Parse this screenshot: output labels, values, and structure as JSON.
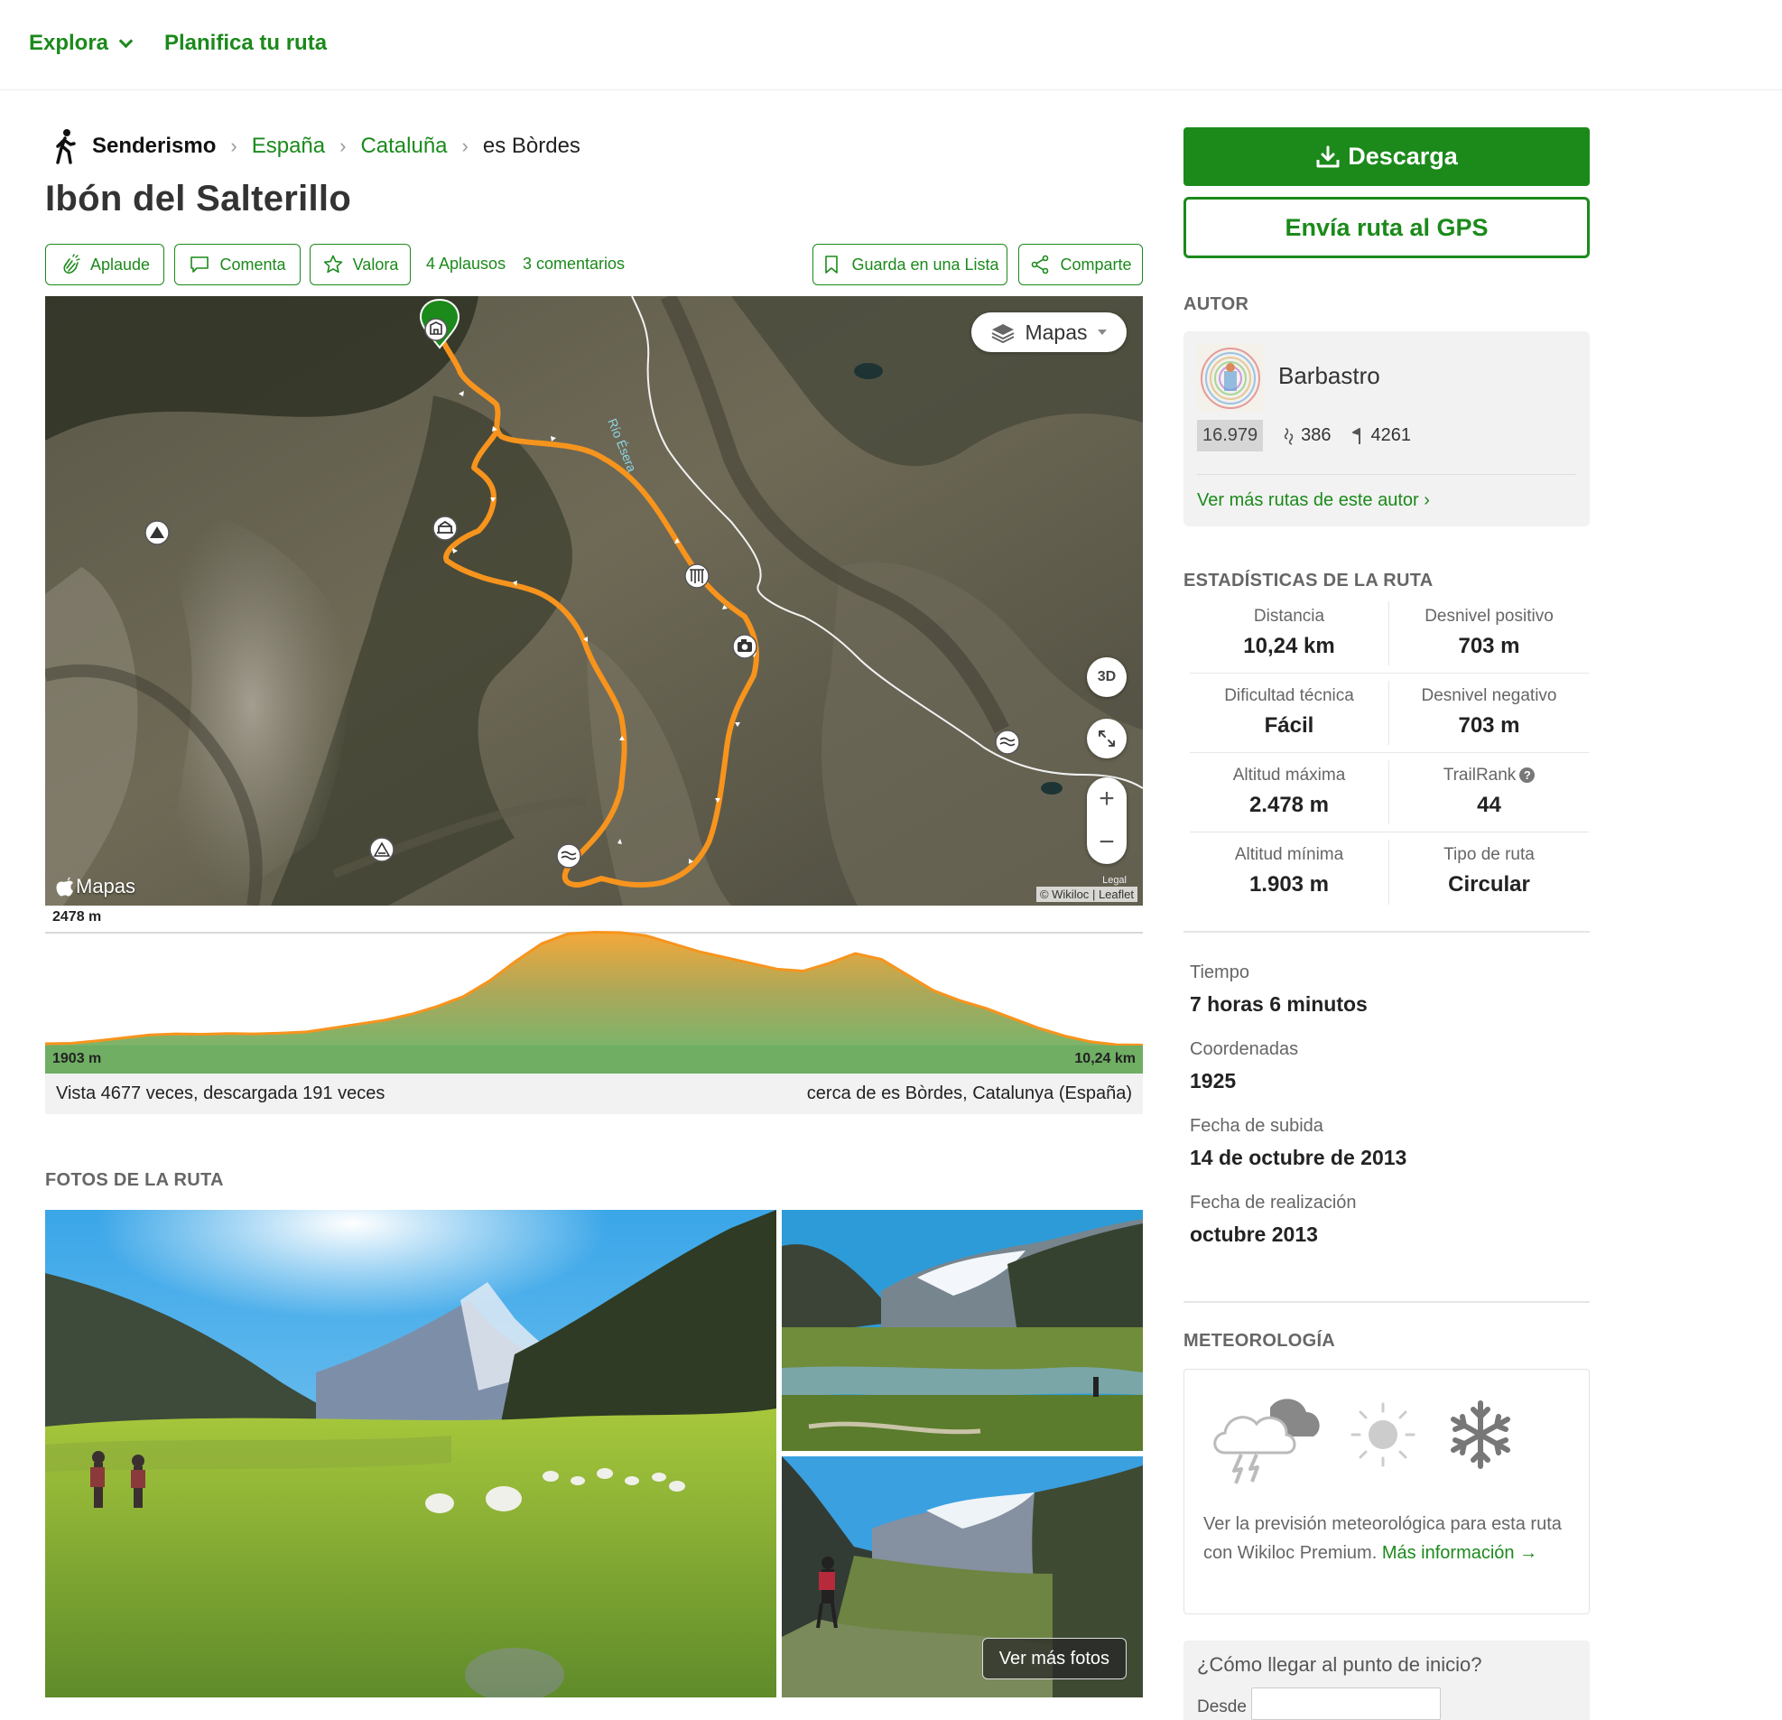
{
  "nav": {
    "explore_label": "Explora",
    "plan_label": "Planifica tu ruta"
  },
  "breadcrumb": {
    "activity": "Senderismo",
    "items": [
      "España",
      "Cataluña"
    ],
    "current": "es Bòrdes"
  },
  "title": "Ibón del Salterillo",
  "actions": {
    "clap_label": "Aplaude",
    "comment_label": "Comenta",
    "rate_label": "Valora",
    "claps_link": "4 Aplausos",
    "comments_link": "3 comentarios",
    "save_list_label": "Guarda en una Lista",
    "share_label": "Comparte"
  },
  "map": {
    "layers_label": "Mapas",
    "btn_3d": "3D",
    "zoom_in": "+",
    "zoom_out": "−",
    "river_label": "Río Ésera",
    "attribution_left": "© Wikiloc",
    "attribution_sep": "|",
    "attribution_right": "Leaflet",
    "legal": "Legal",
    "apple_maps": "Mapas",
    "route_color": "#f7941d"
  },
  "elevation": {
    "max_label": "2478 m",
    "min_label": "1903 m",
    "distance_label": "10,24 km",
    "profile": [
      1910,
      1912,
      1925,
      1940,
      1955,
      1960,
      1958,
      1962,
      1960,
      1964,
      1970,
      1990,
      2010,
      2030,
      2060,
      2100,
      2150,
      2230,
      2330,
      2420,
      2470,
      2478,
      2476,
      2460,
      2420,
      2380,
      2350,
      2320,
      2290,
      2280,
      2320,
      2370,
      2340,
      2260,
      2180,
      2130,
      2090,
      2040,
      1990,
      1950,
      1920,
      1905,
      1903
    ]
  },
  "route_info": {
    "views": "Vista 4677 veces, descargada 191 veces",
    "near": "cerca de es Bòrdes, Catalunya (España)"
  },
  "photos": {
    "heading": "FOTOS DE LA RUTA",
    "more_label": "Ver más fotos"
  },
  "sidebar": {
    "download_label": "Descarga",
    "gps_label": "Envía ruta al GPS",
    "author_heading": "AUTOR",
    "author": {
      "name": "Barbastro",
      "rank": "16.979",
      "followers": "386",
      "trails": "4261",
      "more_link": "Ver más rutas de este autor ›"
    },
    "stats_heading": "ESTADÍSTICAS DE LA RUTA",
    "stats": [
      {
        "label": "Distancia",
        "value": "10,24 km"
      },
      {
        "label": "Desnivel positivo",
        "value": "703 m"
      },
      {
        "label": "Dificultad técnica",
        "value": "Fácil"
      },
      {
        "label": "Desnivel negativo",
        "value": "703 m"
      },
      {
        "label": "Altitud máxima",
        "value": "2.478 m"
      },
      {
        "label": "TrailRank",
        "value": "44"
      },
      {
        "label": "Altitud mínima",
        "value": "1.903 m"
      },
      {
        "label": "Tipo de ruta",
        "value": "Circular"
      }
    ],
    "info": [
      {
        "label": "Tiempo",
        "value": "7 horas 6 minutos"
      },
      {
        "label": "Coordenadas",
        "value": "1925"
      },
      {
        "label": "Fecha de subida",
        "value": "14 de octubre de 2013"
      },
      {
        "label": "Fecha de realización",
        "value": "octubre 2013"
      }
    ],
    "weather_heading": "METEOROLOGÍA",
    "weather_text": "Ver la previsión meteorológica para esta ruta con Wikiloc Premium.",
    "weather_link": "Más información →",
    "howto_title": "¿Cómo llegar al punto de inicio?",
    "howto_from": "Desde",
    "howto_placeholder": ""
  },
  "colors": {
    "brand_green": "#1b8a1b",
    "route_orange": "#f7941d"
  }
}
